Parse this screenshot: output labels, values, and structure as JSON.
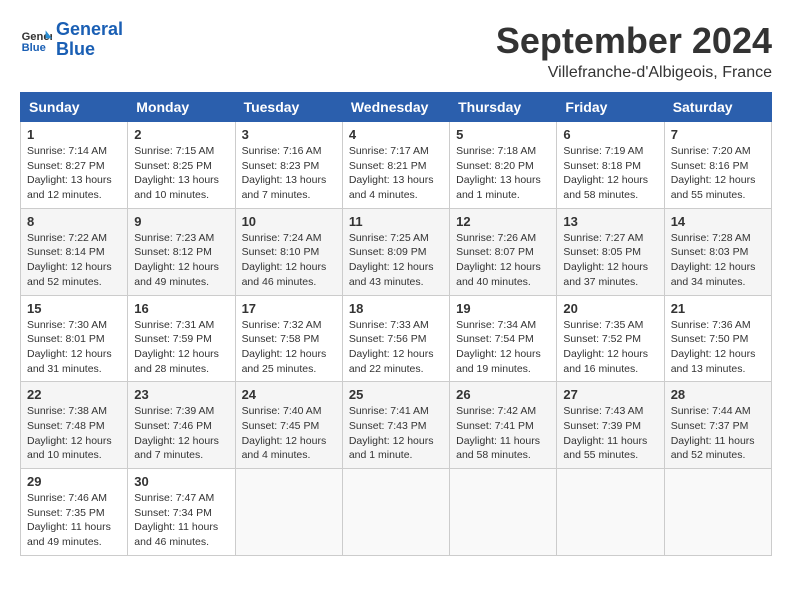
{
  "header": {
    "logo_line1": "General",
    "logo_line2": "Blue",
    "month_title": "September 2024",
    "subtitle": "Villefranche-d'Albigeois, France"
  },
  "weekdays": [
    "Sunday",
    "Monday",
    "Tuesday",
    "Wednesday",
    "Thursday",
    "Friday",
    "Saturday"
  ],
  "weeks": [
    [
      {
        "day": "1",
        "info": "Sunrise: 7:14 AM\nSunset: 8:27 PM\nDaylight: 13 hours and 12 minutes."
      },
      {
        "day": "2",
        "info": "Sunrise: 7:15 AM\nSunset: 8:25 PM\nDaylight: 13 hours and 10 minutes."
      },
      {
        "day": "3",
        "info": "Sunrise: 7:16 AM\nSunset: 8:23 PM\nDaylight: 13 hours and 7 minutes."
      },
      {
        "day": "4",
        "info": "Sunrise: 7:17 AM\nSunset: 8:21 PM\nDaylight: 13 hours and 4 minutes."
      },
      {
        "day": "5",
        "info": "Sunrise: 7:18 AM\nSunset: 8:20 PM\nDaylight: 13 hours and 1 minute."
      },
      {
        "day": "6",
        "info": "Sunrise: 7:19 AM\nSunset: 8:18 PM\nDaylight: 12 hours and 58 minutes."
      },
      {
        "day": "7",
        "info": "Sunrise: 7:20 AM\nSunset: 8:16 PM\nDaylight: 12 hours and 55 minutes."
      }
    ],
    [
      {
        "day": "8",
        "info": "Sunrise: 7:22 AM\nSunset: 8:14 PM\nDaylight: 12 hours and 52 minutes."
      },
      {
        "day": "9",
        "info": "Sunrise: 7:23 AM\nSunset: 8:12 PM\nDaylight: 12 hours and 49 minutes."
      },
      {
        "day": "10",
        "info": "Sunrise: 7:24 AM\nSunset: 8:10 PM\nDaylight: 12 hours and 46 minutes."
      },
      {
        "day": "11",
        "info": "Sunrise: 7:25 AM\nSunset: 8:09 PM\nDaylight: 12 hours and 43 minutes."
      },
      {
        "day": "12",
        "info": "Sunrise: 7:26 AM\nSunset: 8:07 PM\nDaylight: 12 hours and 40 minutes."
      },
      {
        "day": "13",
        "info": "Sunrise: 7:27 AM\nSunset: 8:05 PM\nDaylight: 12 hours and 37 minutes."
      },
      {
        "day": "14",
        "info": "Sunrise: 7:28 AM\nSunset: 8:03 PM\nDaylight: 12 hours and 34 minutes."
      }
    ],
    [
      {
        "day": "15",
        "info": "Sunrise: 7:30 AM\nSunset: 8:01 PM\nDaylight: 12 hours and 31 minutes."
      },
      {
        "day": "16",
        "info": "Sunrise: 7:31 AM\nSunset: 7:59 PM\nDaylight: 12 hours and 28 minutes."
      },
      {
        "day": "17",
        "info": "Sunrise: 7:32 AM\nSunset: 7:58 PM\nDaylight: 12 hours and 25 minutes."
      },
      {
        "day": "18",
        "info": "Sunrise: 7:33 AM\nSunset: 7:56 PM\nDaylight: 12 hours and 22 minutes."
      },
      {
        "day": "19",
        "info": "Sunrise: 7:34 AM\nSunset: 7:54 PM\nDaylight: 12 hours and 19 minutes."
      },
      {
        "day": "20",
        "info": "Sunrise: 7:35 AM\nSunset: 7:52 PM\nDaylight: 12 hours and 16 minutes."
      },
      {
        "day": "21",
        "info": "Sunrise: 7:36 AM\nSunset: 7:50 PM\nDaylight: 12 hours and 13 minutes."
      }
    ],
    [
      {
        "day": "22",
        "info": "Sunrise: 7:38 AM\nSunset: 7:48 PM\nDaylight: 12 hours and 10 minutes."
      },
      {
        "day": "23",
        "info": "Sunrise: 7:39 AM\nSunset: 7:46 PM\nDaylight: 12 hours and 7 minutes."
      },
      {
        "day": "24",
        "info": "Sunrise: 7:40 AM\nSunset: 7:45 PM\nDaylight: 12 hours and 4 minutes."
      },
      {
        "day": "25",
        "info": "Sunrise: 7:41 AM\nSunset: 7:43 PM\nDaylight: 12 hours and 1 minute."
      },
      {
        "day": "26",
        "info": "Sunrise: 7:42 AM\nSunset: 7:41 PM\nDaylight: 11 hours and 58 minutes."
      },
      {
        "day": "27",
        "info": "Sunrise: 7:43 AM\nSunset: 7:39 PM\nDaylight: 11 hours and 55 minutes."
      },
      {
        "day": "28",
        "info": "Sunrise: 7:44 AM\nSunset: 7:37 PM\nDaylight: 11 hours and 52 minutes."
      }
    ],
    [
      {
        "day": "29",
        "info": "Sunrise: 7:46 AM\nSunset: 7:35 PM\nDaylight: 11 hours and 49 minutes."
      },
      {
        "day": "30",
        "info": "Sunrise: 7:47 AM\nSunset: 7:34 PM\nDaylight: 11 hours and 46 minutes."
      },
      {
        "day": "",
        "info": ""
      },
      {
        "day": "",
        "info": ""
      },
      {
        "day": "",
        "info": ""
      },
      {
        "day": "",
        "info": ""
      },
      {
        "day": "",
        "info": ""
      }
    ]
  ]
}
